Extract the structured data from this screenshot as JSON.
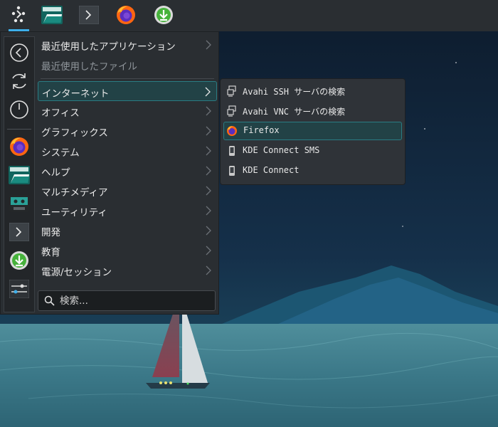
{
  "colors": {
    "accent": "#3daee9",
    "highlight_bg": "#224246",
    "highlight_border": "#2a7c83",
    "panel": "#2a2e32"
  },
  "panel": {
    "items": [
      {
        "name": "application-launcher",
        "icon": "kde-launcher-icon"
      },
      {
        "name": "file-manager",
        "icon": "folder-icon"
      },
      {
        "name": "terminal",
        "icon": "terminal-icon"
      },
      {
        "name": "firefox",
        "icon": "firefox-icon"
      },
      {
        "name": "software-updater",
        "icon": "download-icon"
      }
    ]
  },
  "favorites": [
    {
      "name": "back",
      "icon": "back-icon"
    },
    {
      "name": "restart",
      "icon": "restart-icon"
    },
    {
      "name": "power",
      "icon": "power-icon"
    },
    {
      "name": "firefox",
      "icon": "firefox-icon"
    },
    {
      "name": "file-manager",
      "icon": "folder-icon"
    },
    {
      "name": "cassette",
      "icon": "cassette-icon"
    },
    {
      "name": "terminal",
      "icon": "terminal-icon"
    },
    {
      "name": "updater",
      "icon": "download-icon"
    },
    {
      "name": "settings",
      "icon": "settings-icon"
    }
  ],
  "menu": {
    "recent_apps": "最近使用したアプリケーション",
    "recent_files": "最近使用したファイル",
    "categories": [
      "インターネット",
      "オフィス",
      "グラフィックス",
      "システム",
      "ヘルプ",
      "マルチメディア",
      "ユーティリティ",
      "開発",
      "教育",
      "電源/セッション"
    ],
    "search_placeholder": "検索..."
  },
  "submenu": {
    "items": [
      {
        "label": "Avahi SSH サーバの検索",
        "icon": "network-icon"
      },
      {
        "label": "Avahi VNC サーバの検索",
        "icon": "network-icon"
      },
      {
        "label": "Firefox",
        "icon": "firefox-icon"
      },
      {
        "label": "KDE Connect SMS",
        "icon": "phone-icon"
      },
      {
        "label": "KDE Connect",
        "icon": "phone-icon"
      }
    ]
  }
}
